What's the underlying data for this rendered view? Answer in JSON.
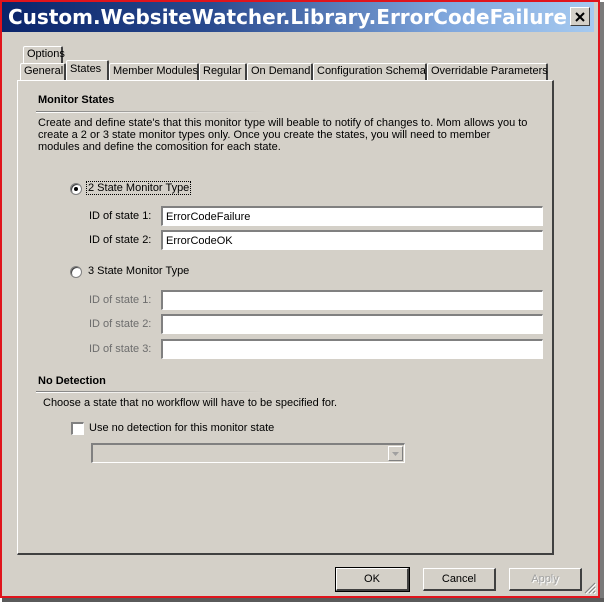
{
  "window": {
    "title": "Custom.WebsiteWatcher.Library.ErrorCodeFailure",
    "close_icon": "close-icon"
  },
  "tabs": {
    "row1": [
      {
        "label": "Options",
        "selected": false
      }
    ],
    "row2": [
      {
        "label": "General",
        "selected": false
      },
      {
        "label": "States",
        "selected": true
      },
      {
        "label": "Member Modules",
        "selected": false
      },
      {
        "label": "Regular",
        "selected": false
      },
      {
        "label": "On Demand",
        "selected": false
      },
      {
        "label": "Configuration Schema",
        "selected": false
      },
      {
        "label": "Overridable Parameters",
        "selected": false
      }
    ]
  },
  "monitor_states": {
    "heading": "Monitor States",
    "description_lines": [
      "Create and define state's that this monitor type will beable to notify of changes to.  Mom allows you to",
      "create a 2 or 3 state monitor types only.  Once you create the states, you will need to member",
      "modules and define the comosition for each state."
    ],
    "two_state": {
      "label": "2 State Monitor Type",
      "selected": true,
      "fields": [
        {
          "label": "ID of state 1:",
          "value": "ErrorCodeFailure"
        },
        {
          "label": "ID of state 2:",
          "value": "ErrorCodeOK"
        }
      ]
    },
    "three_state": {
      "label": "3 State Monitor Type",
      "selected": false,
      "fields": [
        {
          "label": "ID of state 1:",
          "value": ""
        },
        {
          "label": "ID of state 2:",
          "value": ""
        },
        {
          "label": "ID of state 3:",
          "value": ""
        }
      ]
    }
  },
  "no_detection": {
    "heading": "No Detection",
    "description": "Choose a state that no workflow will have to be specified for.",
    "checkbox_label": "Use no detection for this monitor state",
    "checked": false,
    "dropdown_value": ""
  },
  "buttons": {
    "ok": "OK",
    "cancel": "Cancel",
    "apply": "Apply"
  }
}
